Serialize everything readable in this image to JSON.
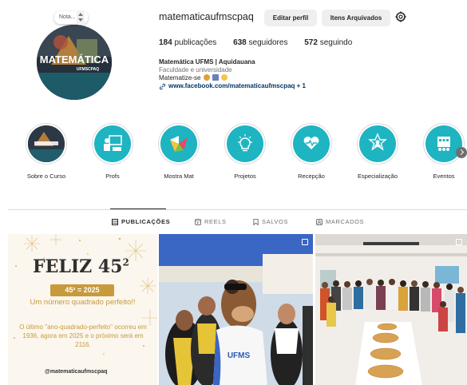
{
  "profile": {
    "username": "matematicaufmscpaq",
    "edit_profile_label": "Editar perfil",
    "archive_label": "Itens Arquivados",
    "note_placeholder": "Nota...",
    "avatar_text": "MATEMÁTICA",
    "avatar_subtext": "UFMSCPAQ",
    "stats": {
      "posts_count": "184",
      "posts_label": "publicações",
      "followers_count": "638",
      "followers_label": "seguidores",
      "following_count": "572",
      "following_label": "seguindo"
    },
    "bio": {
      "name": "Matemática UFMS | Aquidauana",
      "category": "Faculdade e universidade",
      "line": "Matematize-se",
      "link": "www.facebook.com/matematicaufmscpaq + 1"
    }
  },
  "highlights": [
    {
      "label": "Sobre o Curso",
      "icon": "course-cover"
    },
    {
      "label": "Profs",
      "icon": "teacher-board-icon"
    },
    {
      "label": "Mostra Mat",
      "icon": "origami-bird-icon"
    },
    {
      "label": "Projetos",
      "icon": "lightbulb-icon"
    },
    {
      "label": "Recepção",
      "icon": "heart-hand-icon"
    },
    {
      "label": "Especialização",
      "icon": "graduate-star-icon"
    },
    {
      "label": "Eventos",
      "icon": "calendar-people-icon"
    }
  ],
  "tabs": [
    {
      "label": "PUBLICAÇÕES",
      "active": true
    },
    {
      "label": "REELS",
      "active": false
    },
    {
      "label": "SALVOS",
      "active": false
    },
    {
      "label": "MARCADOS",
      "active": false
    }
  ],
  "posts": {
    "first": {
      "title": "FELIZ 45",
      "title_sup": "2",
      "badge": "45² = 2025",
      "subtitle": "Um número quadrado perfeito!!",
      "body": "O último \"ano-quadrado-perfeito\" ocorreu em 1936, agora em 2025 e o próximo será em 2116.",
      "handle": "@matematicaufmscpaq"
    },
    "second": {
      "shirt_text": "UFMS"
    }
  },
  "colors": {
    "highlight_teal": "#1eb4c2",
    "link_blue": "#00376b",
    "gold": "#c79a3c",
    "button_gray": "#efefef"
  }
}
